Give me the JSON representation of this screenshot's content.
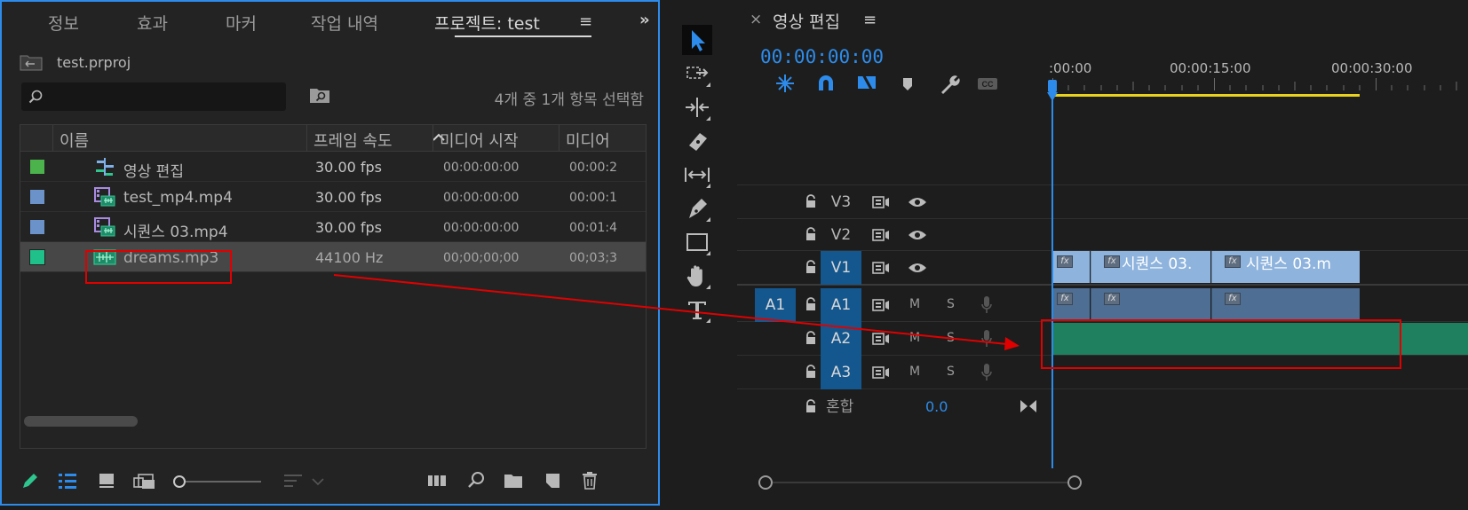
{
  "project_panel": {
    "tabs": [
      {
        "label": "정보",
        "active": false
      },
      {
        "label": "효과",
        "active": false
      },
      {
        "label": "마커",
        "active": false
      },
      {
        "label": "작업 내역",
        "active": false
      },
      {
        "label": "프로젝트: test",
        "active": true
      }
    ],
    "tab_menu_glyph": "≡",
    "overflow_glyph": "»",
    "project_file": "test.prproj",
    "search": {
      "value": "",
      "placeholder": ""
    },
    "selection_status": "4개 중 1개 항목 선택함",
    "columns": [
      "이름",
      "프레임 속도",
      "미디어 시작",
      "미디어"
    ],
    "sort_column": "프레임 속도",
    "items": [
      {
        "label_color": "#4cb34c",
        "icon": "sequence-icon",
        "name": "영상 편집",
        "frame_rate": "30.00 fps",
        "media_start": "00:00:00:00",
        "media_end": "00:00:2",
        "selected": false
      },
      {
        "label_color": "#6b93c9",
        "icon": "video-file-icon",
        "name": "test_mp4.mp4",
        "frame_rate": "30.00 fps",
        "media_start": "00:00:00:00",
        "media_end": "00:00:1",
        "selected": false
      },
      {
        "label_color": "#6b93c9",
        "icon": "video-file-icon",
        "name": "시퀀스 03.mp4",
        "frame_rate": "30.00 fps",
        "media_start": "00:00:00:00",
        "media_end": "00:01:4",
        "selected": false
      },
      {
        "label_color": "#20c08a",
        "icon": "audio-file-icon",
        "name": "dreams.mp3",
        "frame_rate": "44100 Hz",
        "media_start": "00;00;00;00",
        "media_end": "00;03;3",
        "selected": true
      }
    ]
  },
  "timeline_panel": {
    "close_glyph": "×",
    "title": "영상 편집",
    "menu_glyph": "≡",
    "timecode": "00:00:00:00",
    "ruler_labels": [
      ":00:00",
      "00:00:15:00",
      "00:00:30:00"
    ],
    "tracks": {
      "video": [
        {
          "label": "V3",
          "targeted": false
        },
        {
          "label": "V2",
          "targeted": false
        },
        {
          "label": "V1",
          "targeted": true
        }
      ],
      "audio": [
        {
          "label": "A1",
          "source": "A1",
          "targeted": true
        },
        {
          "label": "A2",
          "targeted": true
        },
        {
          "label": "A3",
          "targeted": true
        }
      ],
      "mute_label": "M",
      "solo_label": "S"
    },
    "mix": {
      "label": "혼합",
      "value": "0.0"
    },
    "clips": {
      "fx_label": "fx",
      "v1": [
        "시퀀스 03.",
        "시퀀스 03.m"
      ]
    }
  },
  "colors": {
    "accent": "#2d8ceb",
    "annotation": "#e00000",
    "audio_clip": "#1f8060",
    "video_clip": "#8eb3dd",
    "work_area": "#e8d21f"
  }
}
